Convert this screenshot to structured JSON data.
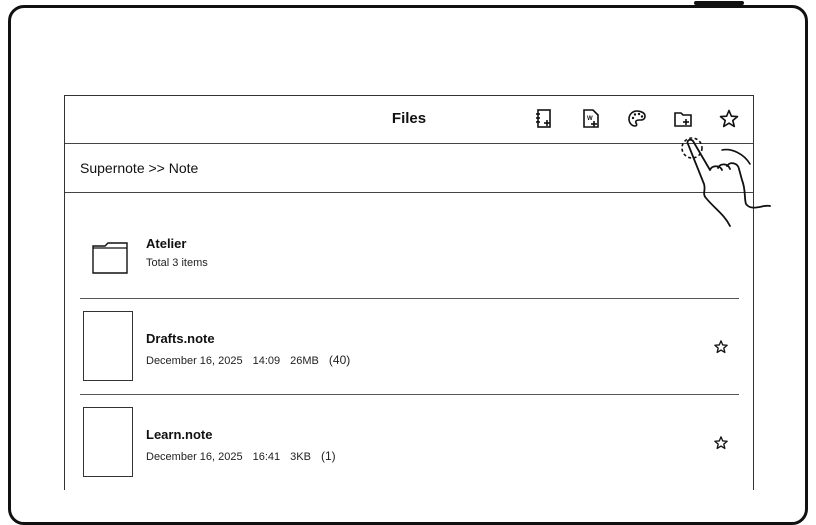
{
  "header": {
    "title": "Files",
    "tools": [
      {
        "name": "new-note-icon"
      },
      {
        "name": "new-document-icon"
      },
      {
        "name": "palette-icon"
      },
      {
        "name": "new-folder-icon"
      },
      {
        "name": "star-icon"
      }
    ]
  },
  "breadcrumb": {
    "path": "Supernote >> Note"
  },
  "items": [
    {
      "type": "folder",
      "name": "Atelier",
      "meta": "Total 3 items"
    },
    {
      "type": "note",
      "name": "Drafts.note",
      "date": "December 16, 2025",
      "time": "14:09",
      "size": "26MB",
      "pages": "(40)"
    },
    {
      "type": "note",
      "name": "Learn.note",
      "date": "December 16, 2025",
      "time": "16:41",
      "size": "3KB",
      "pages": "(1)"
    }
  ]
}
